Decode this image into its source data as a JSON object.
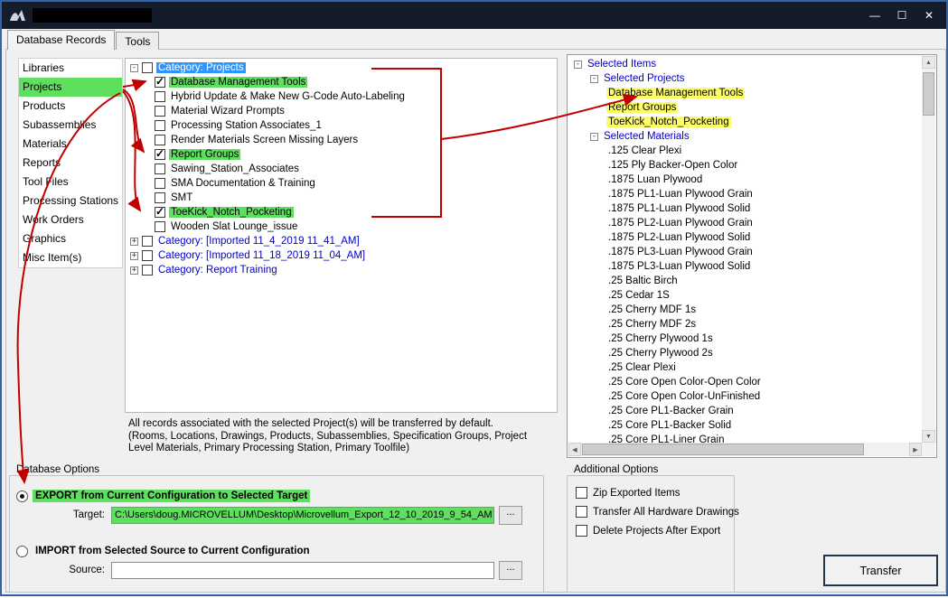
{
  "window": {
    "title": "",
    "controls": {
      "minimize": "—",
      "maximize": "☐",
      "close": "✕"
    }
  },
  "tabs": [
    {
      "label": "Database Records",
      "active": true
    },
    {
      "label": "Tools",
      "active": false
    }
  ],
  "sidebar": {
    "items": [
      {
        "label": "Libraries"
      },
      {
        "label": "Projects",
        "selected": true
      },
      {
        "label": "Products"
      },
      {
        "label": "Subassemblies"
      },
      {
        "label": "Materials"
      },
      {
        "label": "Reports"
      },
      {
        "label": "Tool Files"
      },
      {
        "label": "Processing Stations"
      },
      {
        "label": "Work Orders"
      },
      {
        "label": "Graphics"
      },
      {
        "label": "Misc Item(s)"
      }
    ]
  },
  "glyphs": {
    "collapse": "-",
    "expand": "+",
    "scroll_up": "▲",
    "scroll_down": "▼",
    "scroll_left": "◀",
    "scroll_right": "▶"
  },
  "tree": {
    "root_label": "Category: Projects",
    "children": [
      {
        "label": "Database Management Tools",
        "checked": true,
        "highlight": true
      },
      {
        "label": "Hybrid Update & Make New G-Code Auto-Labeling",
        "checked": false
      },
      {
        "label": "Material Wizard Prompts",
        "checked": false
      },
      {
        "label": "Processing Station Associates_1",
        "checked": false
      },
      {
        "label": "Render Materials Screen Missing Layers",
        "checked": false
      },
      {
        "label": "Report Groups",
        "checked": true,
        "highlight": true
      },
      {
        "label": "Sawing_Station_Associates",
        "checked": false
      },
      {
        "label": "SMA Documentation & Training",
        "checked": false
      },
      {
        "label": "SMT",
        "checked": false
      },
      {
        "label": "ToeKick_Notch_Pocketing",
        "checked": true,
        "highlight": true
      },
      {
        "label": "Wooden Slat Lounge_issue",
        "checked": false
      }
    ],
    "collapsed_categories": [
      {
        "label": "Category: [Imported 11_4_2019 11_41_AM]"
      },
      {
        "label": "Category: [Imported 11_18_2019 11_04_AM]"
      },
      {
        "label": "Category: Report Training"
      }
    ],
    "note_lines": [
      "All records associated with the selected Project(s) will be transferred by default.",
      "(Rooms, Locations, Drawings, Products, Subassemblies, Specification Groups, Project",
      "Level Materials, Primary Processing Station, Primary Toolfile)"
    ]
  },
  "selected_panel": {
    "root_label": "Selected Items",
    "projects_label": "Selected Projects",
    "projects": [
      "Database Management Tools",
      "Report Groups",
      "ToeKick_Notch_Pocketing"
    ],
    "materials_label": "Selected Materials",
    "materials": [
      ".125 Clear Plexi",
      ".125 Ply Backer-Open Color",
      ".1875 Luan Plywood",
      ".1875 PL1-Luan Plywood Grain",
      ".1875 PL1-Luan Plywood Solid",
      ".1875 PL2-Luan Plywood Grain",
      ".1875 PL2-Luan Plywood Solid",
      ".1875 PL3-Luan Plywood Grain",
      ".1875 PL3-Luan Plywood Solid",
      ".25 Baltic Birch",
      ".25 Cedar 1S",
      ".25 Cherry MDF 1s",
      ".25 Cherry MDF 2s",
      ".25 Cherry Plywood 1s",
      ".25 Cherry Plywood 2s",
      ".25 Clear Plexi",
      ".25 Core Open Color-Open Color",
      ".25 Core Open Color-UnFinished",
      ".25 Core PL1-Backer Grain",
      ".25 Core PL1-Backer Solid",
      ".25 Core PL1-Liner Grain"
    ]
  },
  "database_options": {
    "title": "Database Options",
    "export_label": "EXPORT from Current Configuration to Selected Target",
    "export_selected": true,
    "target_label": "Target:",
    "target_value": "C:\\Users\\doug.MICROVELLUM\\Desktop\\Microvellum_Export_12_10_2019_9_54_AM",
    "browse_label": "...",
    "import_label": "IMPORT from Selected Source to Current Configuration",
    "import_selected": false,
    "source_label": "Source:",
    "source_value": ""
  },
  "additional_options": {
    "title": "Additional Options",
    "checkboxes": [
      {
        "label": "Zip Exported Items",
        "checked": false
      },
      {
        "label": "Transfer All Hardware Drawings",
        "checked": false
      },
      {
        "label": "Delete Projects After Export",
        "checked": false
      }
    ]
  },
  "transfer_button_label": "Transfer",
  "colors": {
    "highlight_green": "#5ee05e",
    "selection_blue": "#2e97ff",
    "highlight_yellow": "#fdfd66",
    "annotation_red": "#c00000",
    "titlebar": "#141b2a",
    "window_border": "#2f64ad"
  }
}
